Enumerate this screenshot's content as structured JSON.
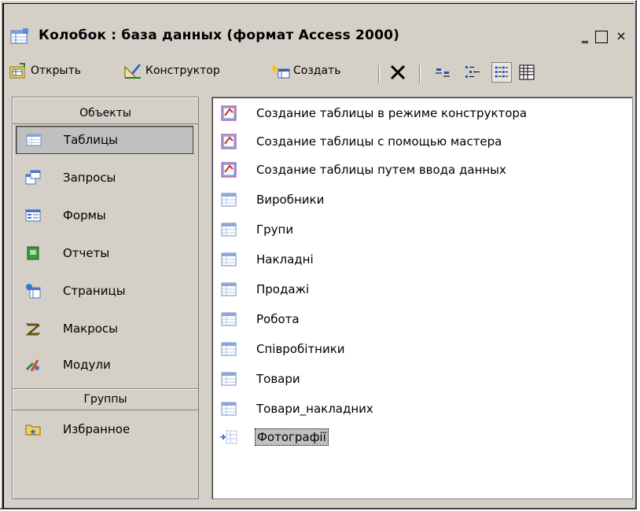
{
  "window": {
    "title": "Колобок : база данных (формат Access 2000)",
    "controls": {
      "minimize": "_",
      "maximize": "□",
      "close": "×"
    }
  },
  "toolbar": {
    "open_label": "Открыть",
    "design_label": "Конструктор",
    "create_label": "Создать"
  },
  "sidebar": {
    "objects_header": "Объекты",
    "groups_header": "Группы",
    "items": [
      {
        "label": "Таблицы",
        "icon": "table-icon",
        "selected": true
      },
      {
        "label": "Запросы",
        "icon": "query-icon"
      },
      {
        "label": "Формы",
        "icon": "form-icon"
      },
      {
        "label": "Отчеты",
        "icon": "report-icon"
      },
      {
        "label": "Страницы",
        "icon": "page-icon"
      },
      {
        "label": "Макросы",
        "icon": "macro-icon"
      },
      {
        "label": "Модули",
        "icon": "module-icon"
      }
    ],
    "groups": [
      {
        "label": "Избранное",
        "icon": "favorites-folder-icon"
      }
    ]
  },
  "list": {
    "items": [
      {
        "label": "Создание таблицы в режиме конструктора",
        "icon": "wizard-icon"
      },
      {
        "label": "Создание таблицы с помощью мастера",
        "icon": "wizard-icon"
      },
      {
        "label": "Создание таблицы путем ввода данных",
        "icon": "wizard-icon"
      },
      {
        "label": "Виробники",
        "icon": "table-icon"
      },
      {
        "label": "Групи",
        "icon": "table-icon"
      },
      {
        "label": "Накладні",
        "icon": "table-icon"
      },
      {
        "label": "Продажі",
        "icon": "table-icon"
      },
      {
        "label": "Робота",
        "icon": "table-icon"
      },
      {
        "label": "Співробітники",
        "icon": "table-icon"
      },
      {
        "label": "Товари",
        "icon": "table-icon"
      },
      {
        "label": "Товари_накладних",
        "icon": "table-icon"
      },
      {
        "label": "Фотографії",
        "icon": "linked-table-icon",
        "selected": true
      }
    ]
  }
}
